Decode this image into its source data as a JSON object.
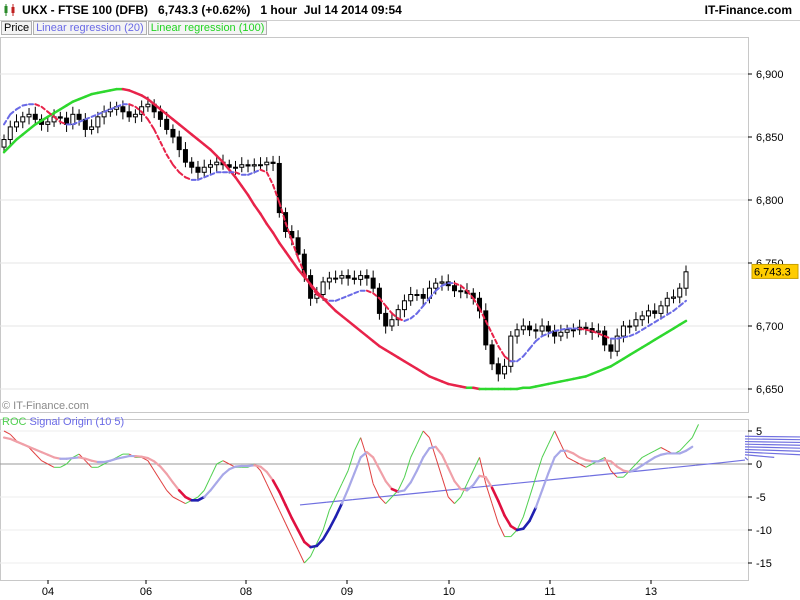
{
  "header": {
    "text": "UKX - FTSE 100 (DFB)   6,743.3 (+0.62%)   1 hour  Jul 14 2014 09:54",
    "brand": "IT-Finance.com"
  },
  "legend": {
    "price": "Price",
    "lr20": "Linear regression (20)",
    "lr100": "Linear regression (100)"
  },
  "watermark": "© IT-Finance.com",
  "lower_legend": {
    "roc": "ROC",
    "signal": "Signal",
    "origin": "Origin (10 5)"
  },
  "colors": {
    "lr20_up": "#6a6ae6",
    "lr20_down": "#e8234a",
    "lr100_up": "#2ed82e",
    "lr100_down": "#e8234a",
    "roc": "#e04040",
    "roc_pos": "#50d050",
    "signal_pos": "#a8a8e8",
    "signal_neg": "#f0a0a8",
    "signal_strong_up": "#2020b0",
    "signal_strong_down": "#e01040",
    "trendline": "#7070e0",
    "price_tag": "#ffcc00"
  },
  "chart_data": [
    {
      "type": "candlestick",
      "title": "",
      "x_tick_labels": [
        "04",
        "06",
        "08",
        "09",
        "10",
        "11",
        "13"
      ],
      "y_ticks": [
        6650,
        6700,
        6750,
        6800,
        6850,
        6900
      ],
      "y_tick_labels": [
        "6,650",
        "6,700",
        "6,750",
        "6,800",
        "6,850",
        "6,900"
      ],
      "ylim": [
        6640,
        6925
      ],
      "last_price": 6743.3,
      "last_price_label": "6,743.3",
      "price_close": [
        6848,
        6858,
        6862,
        6866,
        6868,
        6864,
        6860,
        6862,
        6866,
        6865,
        6860,
        6868,
        6864,
        6856,
        6858,
        6866,
        6870,
        6872,
        6874,
        6870,
        6866,
        6868,
        6874,
        6876,
        6870,
        6864,
        6856,
        6850,
        6840,
        6830,
        6826,
        6822,
        6826,
        6828,
        6830,
        6828,
        6826,
        6826,
        6828,
        6827,
        6828,
        6828,
        6830,
        6829,
        6790,
        6775,
        6770,
        6757,
        6740,
        6722,
        6725,
        6735,
        6738,
        6738,
        6740,
        6738,
        6737,
        6740,
        6738,
        6730,
        6710,
        6700,
        6705,
        6713,
        6720,
        6725,
        6725,
        6722,
        6730,
        6734,
        6735,
        6732,
        6728,
        6728,
        6726,
        6722,
        6712,
        6685,
        6670,
        6662,
        6668,
        6692,
        6697,
        6700,
        6697,
        6696,
        6700,
        6696,
        6692,
        6695,
        6697,
        6697,
        6699,
        6698,
        6695,
        6696,
        6685,
        6680,
        6692,
        6700,
        6700,
        6705,
        6708,
        6712,
        6710,
        6716,
        6722,
        6723,
        6730,
        6743
      ],
      "series": [
        {
          "name": "Linear regression (20)",
          "values": [
            6860,
            6868,
            6872,
            6875,
            6876,
            6876,
            6874,
            6870,
            6866,
            6862,
            6860,
            6860,
            6862,
            6864,
            6866,
            6868,
            6870,
            6872,
            6874,
            6876,
            6876,
            6874,
            6870,
            6864,
            6856,
            6846,
            6836,
            6828,
            6822,
            6818,
            6816,
            6816,
            6818,
            6820,
            6822,
            6822,
            6822,
            6822,
            6820,
            6820,
            6822,
            6824,
            6822,
            6812,
            6798,
            6782,
            6768,
            6754,
            6742,
            6732,
            6725,
            6722,
            6720,
            6720,
            6722,
            6724,
            6726,
            6728,
            6728,
            6726,
            6722,
            6716,
            6710,
            6706,
            6704,
            6706,
            6710,
            6716,
            6722,
            6728,
            6732,
            6734,
            6734,
            6732,
            6728,
            6722,
            6714,
            6704,
            6694,
            6684,
            6676,
            6672,
            6672,
            6676,
            6682,
            6688,
            6692,
            6694,
            6696,
            6697,
            6698,
            6698,
            6698,
            6697,
            6696,
            6694,
            6692,
            6690,
            6690,
            6691,
            6692,
            6694,
            6697,
            6700,
            6703,
            6706,
            6709,
            6712,
            6716,
            6720
          ]
        },
        {
          "name": "Linear regression (100)",
          "values": [
            6838,
            6843,
            6848,
            6852,
            6856,
            6860,
            6863,
            6866,
            6869,
            6872,
            6875,
            6878,
            6880,
            6882,
            6884,
            6885,
            6886,
            6887,
            6888,
            6888,
            6887,
            6885,
            6883,
            6880,
            6876,
            6872,
            6868,
            6864,
            6860,
            6856,
            6852,
            6848,
            6844,
            6840,
            6835,
            6830,
            6824,
            6818,
            6811,
            6804,
            6796,
            6789,
            6781,
            6774,
            6766,
            6759,
            6752,
            6745,
            6739,
            6733,
            6727,
            6722,
            6717,
            6712,
            6708,
            6704,
            6700,
            6696,
            6692,
            6688,
            6684,
            6681,
            6678,
            6675,
            6672,
            6669,
            6666,
            6663,
            6660,
            6658,
            6656,
            6654,
            6653,
            6652,
            6651,
            6651,
            6650,
            6650,
            6650,
            6650,
            6650,
            6650,
            6650,
            6651,
            6651,
            6652,
            6653,
            6654,
            6655,
            6656,
            6657,
            6658,
            6659,
            6660,
            6662,
            6664,
            6666,
            6668,
            6671,
            6674,
            6677,
            6680,
            6683,
            6686,
            6689,
            6692,
            6695,
            6698,
            6701,
            6704
          ]
        }
      ]
    },
    {
      "type": "line",
      "title": "",
      "y_ticks": [
        5,
        0,
        -5,
        -10,
        -15
      ],
      "y_tick_labels": [
        "5",
        "0",
        "-5",
        "-10",
        "-15"
      ],
      "ylim": [
        -16.5,
        6.5
      ],
      "series": [
        {
          "name": "ROC",
          "values": [
            5,
            4.5,
            3.5,
            3,
            2.5,
            1.5,
            0.5,
            0,
            -0.5,
            -0.5,
            0,
            1,
            1.5,
            0.5,
            -0.5,
            -0.5,
            0,
            0.5,
            1,
            1.5,
            1.5,
            1,
            1,
            0.5,
            -1,
            -2.5,
            -4,
            -5,
            -5.5,
            -6,
            -5.5,
            -5,
            -4,
            -2,
            0,
            0.5,
            0,
            -0.5,
            -0.5,
            -0.5,
            0,
            -1,
            -3,
            -5,
            -7,
            -9,
            -11,
            -13,
            -15,
            -14,
            -12,
            -10,
            -7,
            -5,
            -3,
            -1,
            2,
            4,
            1,
            -3,
            -5,
            -6,
            -5,
            -4,
            -2,
            1,
            3,
            5,
            4,
            1,
            -2,
            -5,
            -6,
            -5,
            -3,
            -1,
            1,
            -3,
            -6,
            -9,
            -11,
            -11,
            -10,
            -8,
            -5,
            -2,
            1,
            3,
            5,
            3,
            1,
            0.5,
            0,
            -0.5,
            0,
            0.5,
            1,
            -1,
            -2,
            -2,
            -1,
            0,
            1,
            1.5,
            2,
            2.5,
            2,
            1.5,
            2,
            3,
            4,
            6
          ]
        },
        {
          "name": "Signal",
          "values": [
            4,
            3.8,
            3.4,
            3,
            2.6,
            2.2,
            1.8,
            1.4,
            1,
            0.8,
            0.8,
            0.9,
            1,
            0.8,
            0.5,
            0.3,
            0.3,
            0.5,
            0.8,
            1,
            1.2,
            1.2,
            1.1,
            0.9,
            0.4,
            -0.4,
            -1.5,
            -2.8,
            -4,
            -5,
            -5.5,
            -5.5,
            -5,
            -4,
            -2.8,
            -1.6,
            -0.8,
            -0.4,
            -0.3,
            -0.3,
            -0.2,
            -0.4,
            -1.2,
            -2.5,
            -4.2,
            -6.2,
            -8.2,
            -10,
            -11.8,
            -12.6,
            -12.4,
            -11.4,
            -9.8,
            -8,
            -6,
            -3.8,
            -1.4,
            1,
            1.8,
            1,
            -0.8,
            -2.6,
            -3.8,
            -4.2,
            -4,
            -2.8,
            -1,
            1,
            2.4,
            2.6,
            1.4,
            -0.6,
            -2.6,
            -3.8,
            -4,
            -3.2,
            -1.8,
            -2,
            -3.6,
            -5.6,
            -7.8,
            -9.4,
            -10,
            -9.8,
            -8.6,
            -6.6,
            -4,
            -1.4,
            1,
            2,
            2,
            1.6,
            1,
            0.6,
            0.4,
            0.4,
            0.6,
            0.4,
            -0.4,
            -1,
            -1.2,
            -0.8,
            -0.2,
            0.4,
            1,
            1.4,
            1.6,
            1.6,
            1.6,
            2,
            2.6
          ]
        },
        {
          "name": "Origin (10 5)",
          "values": [
            -6.2,
            -5.8,
            -5.4,
            -5,
            -4.6,
            -4.2,
            -3.8,
            -3.4,
            -3,
            -2.6,
            -2.2,
            -1.8,
            -1.4,
            -1,
            -0.6,
            -0.2,
            0.2,
            0.6,
            1,
            1.4,
            1.8,
            2.2,
            2.6,
            3,
            3.4,
            3.8,
            4.2
          ]
        }
      ]
    }
  ]
}
